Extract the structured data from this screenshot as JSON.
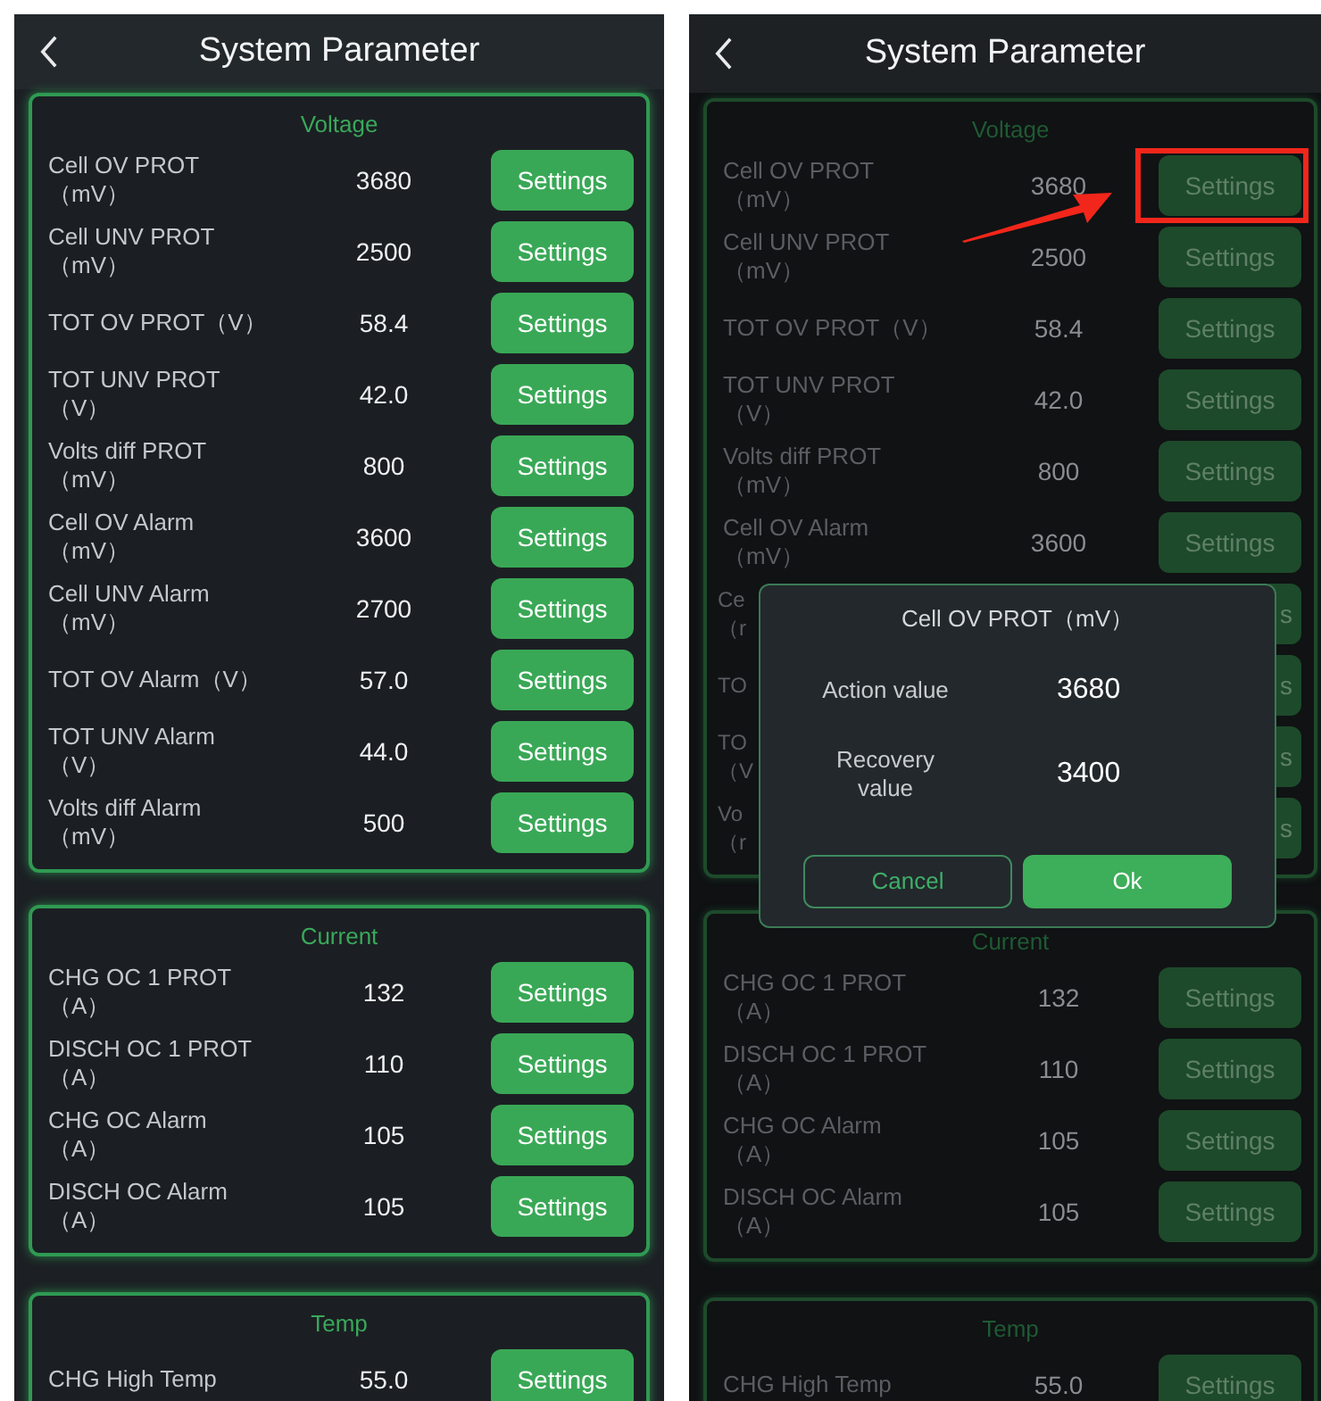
{
  "screens": [
    {
      "dimmed": false,
      "title": "System Parameter",
      "sections": [
        {
          "title": "Voltage",
          "rows": [
            {
              "kind": "row",
              "label": "Cell OV PROT\n（mV）",
              "value": "3680",
              "button": "Settings",
              "highlighted": false
            },
            {
              "kind": "row",
              "label": "Cell UNV PROT\n（mV）",
              "value": "2500",
              "button": "Settings",
              "highlighted": false
            },
            {
              "kind": "row",
              "label": "TOT OV PROT（V）",
              "value": "58.4",
              "button": "Settings",
              "highlighted": false
            },
            {
              "kind": "row",
              "label": "TOT UNV PROT\n（V）",
              "value": "42.0",
              "button": "Settings",
              "highlighted": false
            },
            {
              "kind": "row",
              "label": "Volts diff PROT\n（mV）",
              "value": "800",
              "button": "Settings",
              "highlighted": false
            },
            {
              "kind": "row",
              "label": "Cell OV Alarm\n（mV）",
              "value": "3600",
              "button": "Settings",
              "highlighted": false
            },
            {
              "kind": "row",
              "label": "Cell UNV Alarm\n（mV）",
              "value": "2700",
              "button": "Settings",
              "highlighted": false
            },
            {
              "kind": "row",
              "label": "TOT OV Alarm（V）",
              "value": "57.0",
              "button": "Settings",
              "highlighted": false
            },
            {
              "kind": "row",
              "label": "TOT UNV Alarm\n（V）",
              "value": "44.0",
              "button": "Settings",
              "highlighted": false
            },
            {
              "kind": "row",
              "label": "Volts diff Alarm\n（mV）",
              "value": "500",
              "button": "Settings",
              "highlighted": false
            }
          ]
        },
        {
          "title": "Current",
          "rows": [
            {
              "kind": "row",
              "label": "CHG OC 1 PROT\n（A）",
              "value": "132",
              "button": "Settings",
              "highlighted": false
            },
            {
              "kind": "row",
              "label": "DISCH OC 1 PROT\n（A）",
              "value": "110",
              "button": "Settings",
              "highlighted": false
            },
            {
              "kind": "row",
              "label": "CHG OC Alarm\n（A）",
              "value": "105",
              "button": "Settings",
              "highlighted": false
            },
            {
              "kind": "row",
              "label": "DISCH OC Alarm\n（A）",
              "value": "105",
              "button": "Settings",
              "highlighted": false
            }
          ]
        },
        {
          "title": "Temp",
          "rows": [
            {
              "kind": "row",
              "label": "CHG High Temp",
              "value": "55.0",
              "button": "Settings",
              "highlighted": false
            }
          ]
        }
      ]
    },
    {
      "dimmed": true,
      "title": "System Parameter",
      "sections": [
        {
          "title": "Voltage",
          "rows": [
            {
              "kind": "row",
              "label": "Cell OV PROT\n（mV）",
              "value": "3680",
              "button": "Settings",
              "highlighted": true
            },
            {
              "kind": "row",
              "label": "Cell UNV PROT\n（mV）",
              "value": "2500",
              "button": "Settings",
              "highlighted": false
            },
            {
              "kind": "row",
              "label": "TOT OV PROT（V）",
              "value": "58.4",
              "button": "Settings",
              "highlighted": false
            },
            {
              "kind": "row",
              "label": "TOT UNV PROT\n（V）",
              "value": "42.0",
              "button": "Settings",
              "highlighted": false
            },
            {
              "kind": "row",
              "label": "Volts diff PROT\n（mV）",
              "value": "800",
              "button": "Settings",
              "highlighted": false
            },
            {
              "kind": "row",
              "label": "Cell OV Alarm\n（mV）",
              "value": "3600",
              "button": "Settings",
              "highlighted": false
            },
            {
              "kind": "covered",
              "label": "Ce\n（r",
              "button": "s",
              "highlighted": false
            },
            {
              "kind": "covered",
              "label": "TO",
              "button": "s",
              "highlighted": false
            },
            {
              "kind": "covered",
              "label": "TO\n（V",
              "button": "s",
              "highlighted": false
            },
            {
              "kind": "covered",
              "label": "Vo\n（r",
              "button": "s",
              "highlighted": false
            }
          ]
        },
        {
          "title": "Current",
          "rows": [
            {
              "kind": "row",
              "label": "CHG OC 1 PROT\n（A）",
              "value": "132",
              "button": "Settings",
              "highlighted": false
            },
            {
              "kind": "row",
              "label": "DISCH OC 1 PROT\n（A）",
              "value": "110",
              "button": "Settings",
              "highlighted": false
            },
            {
              "kind": "row",
              "label": "CHG OC Alarm\n（A）",
              "value": "105",
              "button": "Settings",
              "highlighted": false
            },
            {
              "kind": "row",
              "label": "DISCH OC Alarm\n（A）",
              "value": "105",
              "button": "Settings",
              "highlighted": false
            }
          ]
        },
        {
          "title": "Temp",
          "rows": [
            {
              "kind": "row",
              "label": "CHG High Temp",
              "value": "55.0",
              "button": "Settings",
              "highlighted": false
            }
          ]
        }
      ],
      "dialog": {
        "title": "Cell OV PROT（mV）",
        "fields": [
          {
            "label": "Action value",
            "value": "3680"
          },
          {
            "label": "Recovery\nvalue",
            "value": "3400"
          }
        ],
        "buttons": [
          {
            "kind": "secondary",
            "label": "Cancel"
          },
          {
            "kind": "primary",
            "label": "Ok"
          }
        ]
      }
    }
  ]
}
